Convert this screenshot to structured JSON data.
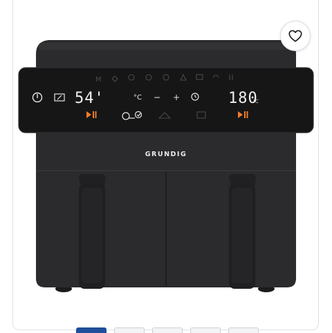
{
  "product": {
    "brand": "GRUNDIG",
    "display": {
      "left_timer": "54'",
      "right_temperature": "180",
      "temperature_unit": "°C",
      "unit_button": "°C",
      "minus": "−",
      "plus": "+",
      "right_unit_small": "℃"
    }
  },
  "favorite": {
    "icon": "heart-icon"
  },
  "gallery": {
    "thumbnail_count": 6,
    "active_index": 0
  },
  "colors": {
    "body": "#2a2a2c",
    "panel": "#1b1b1c",
    "accent_orange": "#ef7c2b",
    "selected_thumb": "#1f4e9a"
  }
}
